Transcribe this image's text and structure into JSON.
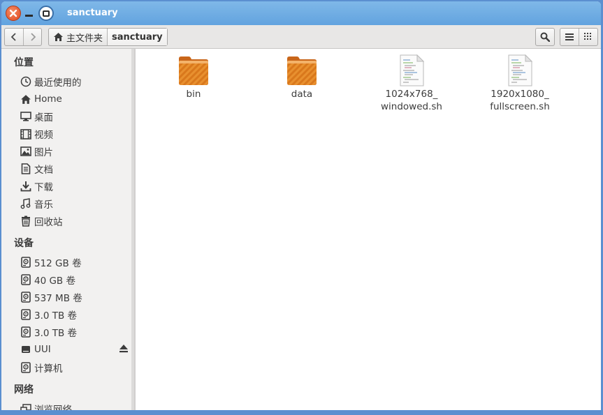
{
  "window": {
    "title": "sanctuary"
  },
  "toolbar": {
    "back_icon": "chevron-left-icon",
    "forward_icon": "chevron-right-icon",
    "breadcrumbs": [
      {
        "label": "主文件夹",
        "icon": "home-icon"
      },
      {
        "label": "sanctuary"
      }
    ],
    "search_icon": "search-icon",
    "view_icons": [
      "list-view-icon",
      "grid-view-icon"
    ]
  },
  "sidebar": {
    "places_header": "位置",
    "places": [
      {
        "label": "最近使用的",
        "icon": "clock-icon"
      },
      {
        "label": "Home",
        "icon": "home-icon"
      },
      {
        "label": "桌面",
        "icon": "desktop-icon"
      },
      {
        "label": "视频",
        "icon": "video-icon"
      },
      {
        "label": "图片",
        "icon": "picture-icon"
      },
      {
        "label": "文档",
        "icon": "document-icon"
      },
      {
        "label": "下载",
        "icon": "download-icon"
      },
      {
        "label": "音乐",
        "icon": "music-icon"
      },
      {
        "label": "回收站",
        "icon": "trash-icon"
      }
    ],
    "devices_header": "设备",
    "devices": [
      {
        "label": "512 GB 卷",
        "icon": "drive-icon"
      },
      {
        "label": "40 GB 卷",
        "icon": "drive-icon"
      },
      {
        "label": "537 MB 卷",
        "icon": "drive-icon"
      },
      {
        "label": "3.0 TB 卷",
        "icon": "drive-icon"
      },
      {
        "label": "3.0 TB 卷",
        "icon": "drive-icon"
      },
      {
        "label": "UUI",
        "icon": "removable-drive-icon",
        "eject": true
      },
      {
        "label": "计算机",
        "icon": "computer-drive-icon"
      }
    ],
    "network_header": "网络",
    "network": [
      {
        "label": "浏览网络",
        "icon": "network-icon"
      }
    ]
  },
  "files": [
    {
      "name": "bin",
      "type": "folder"
    },
    {
      "name": "data",
      "type": "folder"
    },
    {
      "name": "1024x768_\nwindowed.sh",
      "line1": "1024x768_",
      "line2": "windowed.sh",
      "type": "script"
    },
    {
      "name": "1920x1080_\nfullscreen.sh",
      "line1": "1920x1080_",
      "line2": "fullscreen.sh",
      "type": "script"
    }
  ],
  "colors": {
    "titlebar": "#62a3df",
    "close": "#df4a22",
    "folder": "#e58a2b"
  }
}
